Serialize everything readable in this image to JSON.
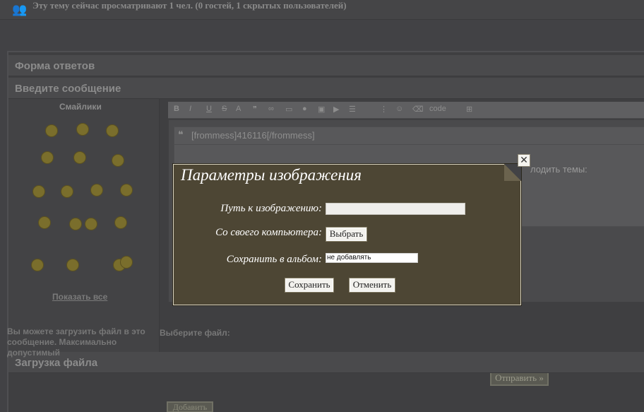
{
  "viewers": {
    "text": "Эту тему сейчас просматривают 1 чел. (0 гостей, 1 скрытых пользователей)"
  },
  "sections": {
    "reply_form": "Форма ответов",
    "enter_message": "Введите сообщение",
    "upload": "Загрузка файла"
  },
  "smiles": {
    "title": "Смайлики",
    "show_all": "Показать все"
  },
  "toolbar": {
    "code_label": "code"
  },
  "editor": {
    "quote_header": "[frommess]416116[/frommess]",
    "quote_text": "лодить темы:"
  },
  "send_button": "Отправить »",
  "upload": {
    "desc": "Вы можете загрузить файл в это сообщение. Максимально допустимый",
    "choose_label": "Выберите файл:",
    "add_button": "Добавить"
  },
  "dialog": {
    "title": "Параметры изображения",
    "path_label": "Путь к изображению:",
    "path_value": "",
    "computer_label": "Со своего компьютера:",
    "browse_button": "Выбрать",
    "album_label": "Сохранить в альбом:",
    "album_value": "не добавлять",
    "save_button": "Сохранить",
    "cancel_button": "Отменить",
    "close": "✕"
  },
  "colors": {
    "dialog_bg": "#4d4634",
    "page_bg": "#424245"
  }
}
